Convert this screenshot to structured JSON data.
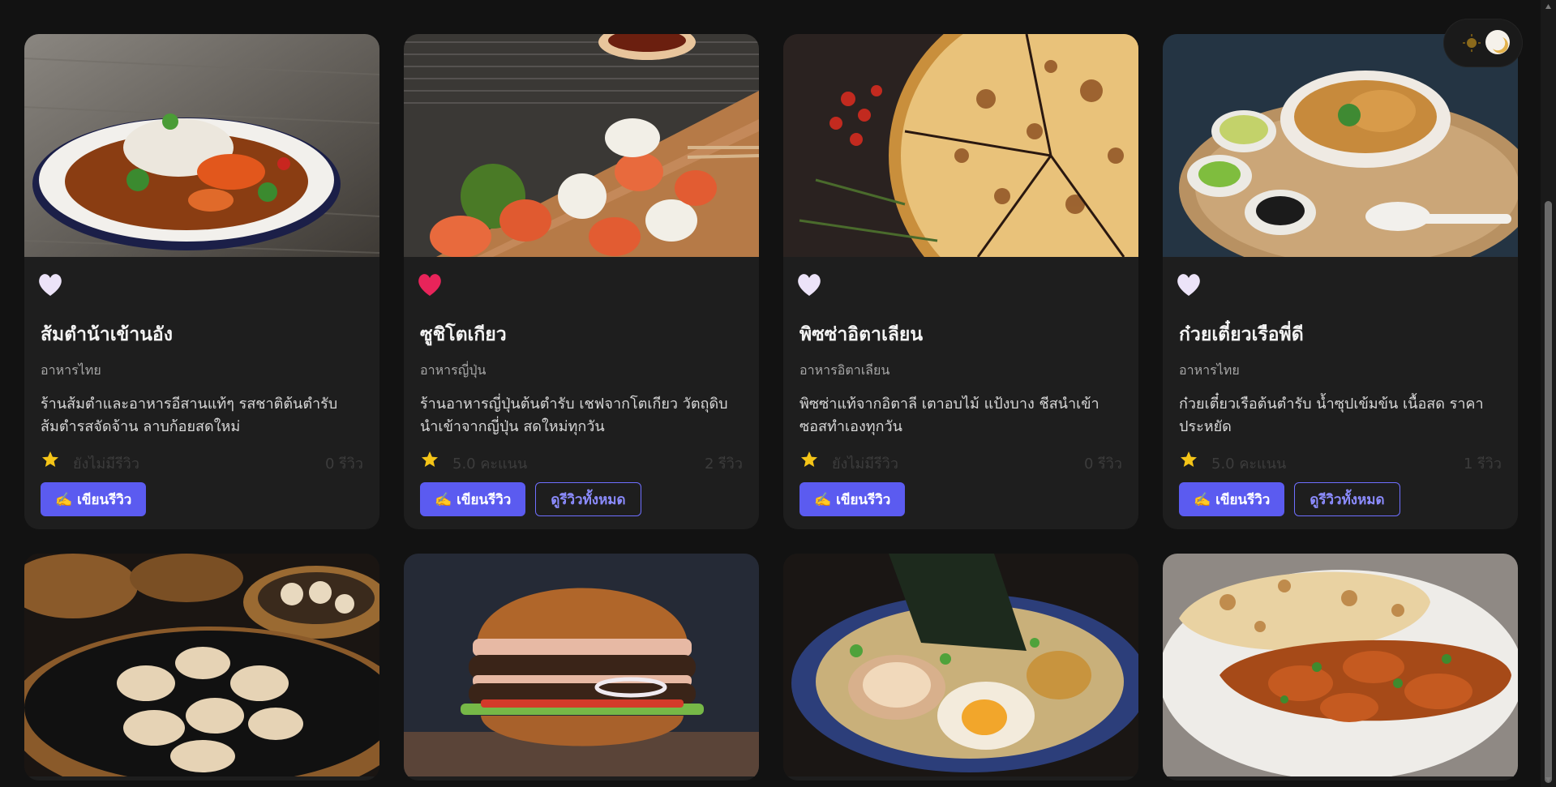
{
  "restaurants": [
    {
      "name": "ส้มตำน้าเข้านอัง",
      "category": "อาหารไทย",
      "description": "ร้านส้มตำและอาหารอีสานแท้ๆ รสชาติต้นตำรับ ส้มตำรสจัดจ้าน ลาบก้อยสดใหม่",
      "rating_text": "ยังไม่มีรีวิว",
      "review_count": "0 รีวิว",
      "favorited": false,
      "write_review_label": "✍️ เขียนรีวิว",
      "image_icon": "curry-bowl-photo"
    },
    {
      "name": "ซูชิโตเกียว",
      "category": "อาหารญี่ปุ่น",
      "description": "ร้านอาหารญี่ปุ่นต้นตำรับ เชฟจากโตเกียว วัตถุดิบนำเข้าจากญี่ปุ่น สดใหม่ทุกวัน",
      "rating_text": "5.0 คะแนน",
      "review_count": "2 รีวิว",
      "favorited": true,
      "write_review_label": "✍️ เขียนรีวิว",
      "view_reviews_label": "ดูรีวิวทั้งหมด",
      "image_icon": "sushi-photo"
    },
    {
      "name": "พิซซ่าอิตาเลียน",
      "category": "อาหารอิตาเลียน",
      "description": "พิซซ่าแท้จากอิตาลี เตาอบไม้ แป้งบาง ชีสนำเข้า ซอสทำเองทุกวัน",
      "rating_text": "ยังไม่มีรีวิว",
      "review_count": "0 รีวิว",
      "favorited": false,
      "write_review_label": "✍️ เขียนรีวิว",
      "image_icon": "pizza-photo"
    },
    {
      "name": "ก๋วยเตี๋ยวเรือพี่ดี",
      "category": "อาหารไทย",
      "description": "ก๋วยเตี๋ยวเรือต้นตำรับ น้ำซุปเข้มข้น เนื้อสด ราคาประหยัด",
      "rating_text": "5.0 คะแนน",
      "review_count": "1 รีวิว",
      "favorited": false,
      "write_review_label": "✍️ เขียนรีวิว",
      "view_reviews_label": "ดูรีวิวทั้งหมด",
      "image_icon": "noodle-bowl-photo"
    }
  ],
  "second_row": [
    {
      "image_icon": "dumplings-photo"
    },
    {
      "image_icon": "burger-photo"
    },
    {
      "image_icon": "ramen-photo"
    },
    {
      "image_icon": "curry-naan-photo"
    }
  ],
  "theme_toggle": {
    "icon_left": "sun-icon",
    "icon_right": "moon-icon"
  },
  "colors": {
    "background": "#121212",
    "card": "#1e1e1e",
    "primary_button": "#5b5bf0",
    "outline_button": "#8c8cff",
    "heart_active": "#e8245a",
    "heart_inactive": "#e9e0f7",
    "star": "#f5c518"
  }
}
